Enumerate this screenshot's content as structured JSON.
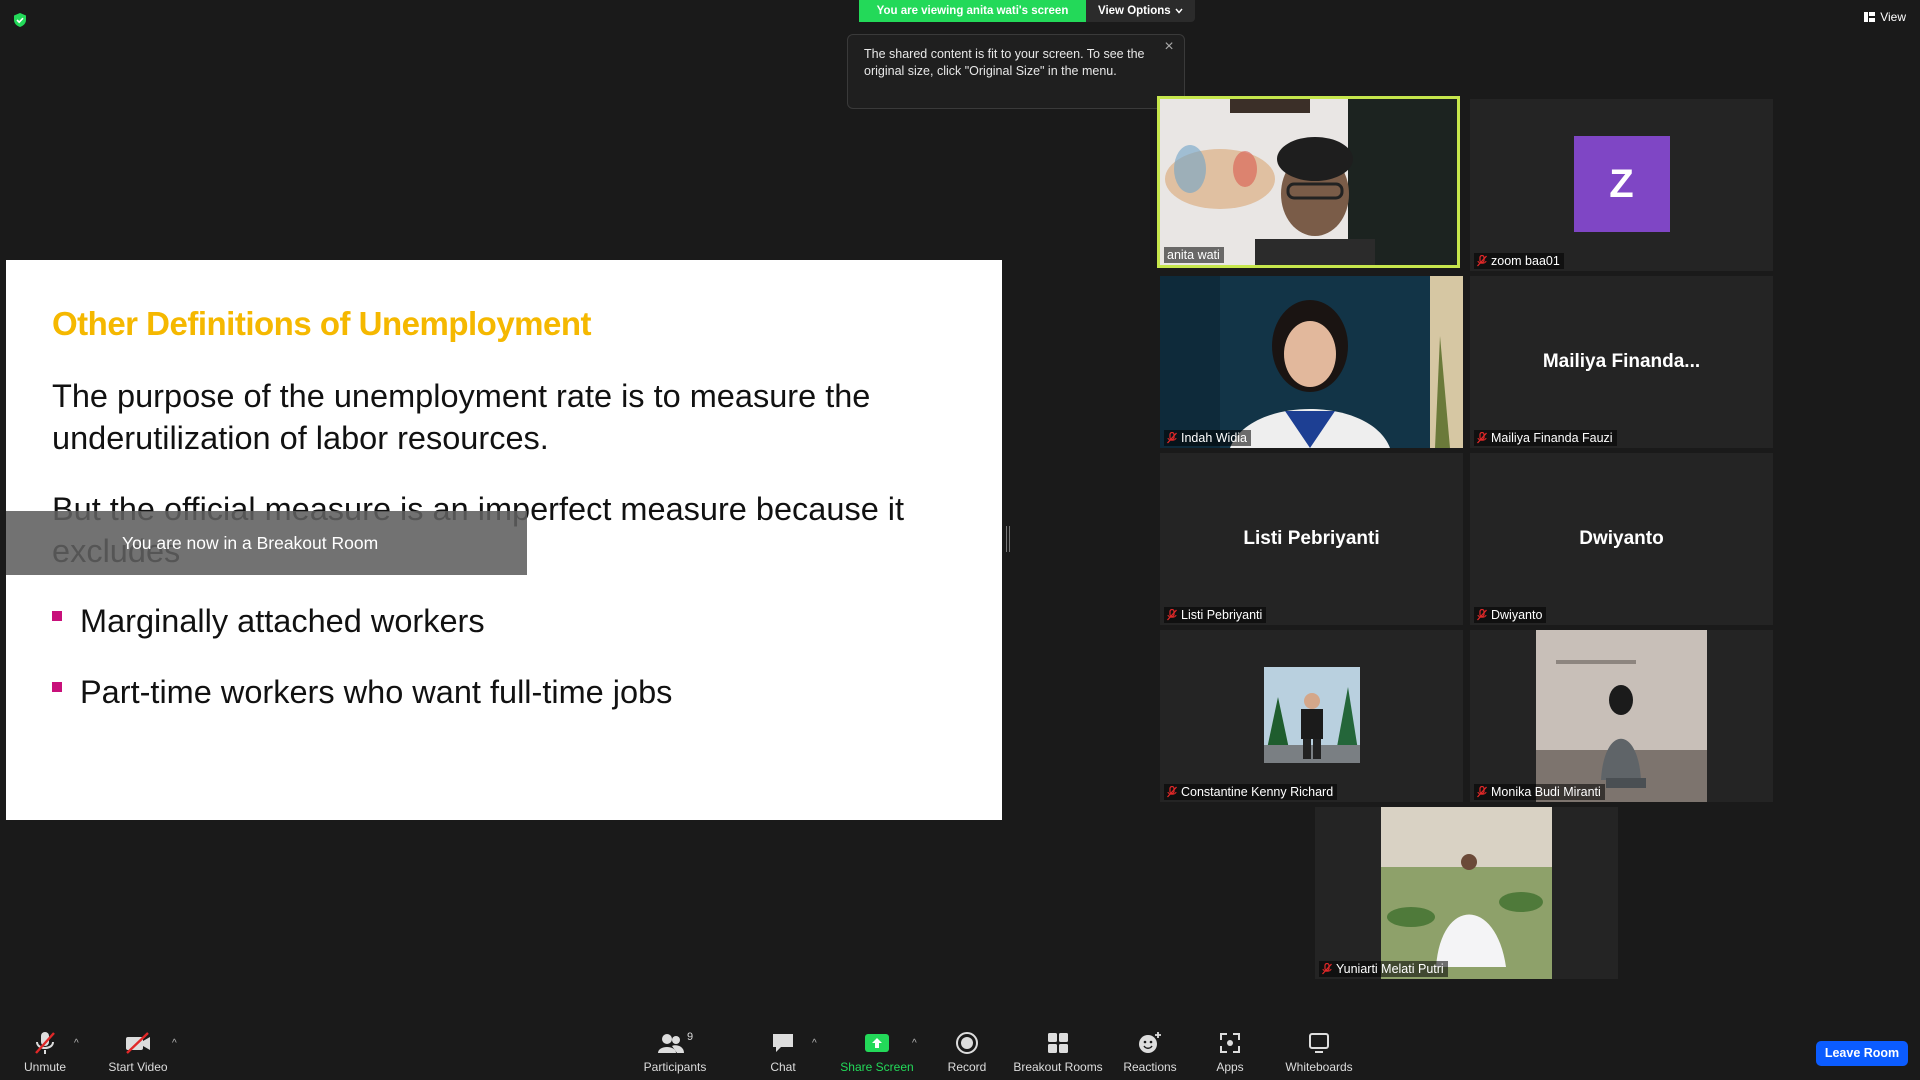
{
  "banner": {
    "viewing_text": "You are viewing anita wati's screen",
    "view_options_label": "View Options"
  },
  "top_right": {
    "view_label": "View"
  },
  "tooltip": {
    "text": "The shared content is fit to your screen. To see the original size, click \"Original Size\" in the menu."
  },
  "slide": {
    "title": "Other Definitions of Unemployment",
    "para1": "The purpose of the unemployment rate is to measure the underutilization of labor resources.",
    "para2": "But the official measure is an imperfect measure because it excludes",
    "bullets": [
      "Marginally attached workers",
      "Part-time workers who want full-time jobs"
    ],
    "title_color": "#f5b800",
    "bullet_color": "#c8107a"
  },
  "breakout_toast": "You are now in a Breakout Room",
  "participants": [
    {
      "label": "anita wati",
      "center_name": "",
      "muted": false,
      "active": true
    },
    {
      "label": "zoom baa01",
      "center_name": "",
      "avatar_letter": "Z",
      "muted": true
    },
    {
      "label": "Indah Widia",
      "center_name": "",
      "muted": true
    },
    {
      "label": "Mailiya Finanda Fauzi",
      "center_name": "Mailiya  Finanda...",
      "muted": true
    },
    {
      "label": "Listi Pebriyanti",
      "center_name": "Listi Pebriyanti",
      "muted": true
    },
    {
      "label": "Dwiyanto",
      "center_name": "Dwiyanto",
      "muted": true
    },
    {
      "label": "Constantine Kenny Richard",
      "center_name": "",
      "muted": true
    },
    {
      "label": "Monika Budi Miranti",
      "center_name": "",
      "muted": true
    },
    {
      "label": "Yuniarti Melati Putri",
      "center_name": "",
      "muted": true
    }
  ],
  "toolbar": {
    "unmute": "Unmute",
    "start_video": "Start Video",
    "participants": "Participants",
    "participants_count": "9",
    "chat": "Chat",
    "share_screen": "Share Screen",
    "record": "Record",
    "breakout_rooms": "Breakout Rooms",
    "reactions": "Reactions",
    "apps": "Apps",
    "whiteboards": "Whiteboards",
    "leave_room": "Leave Room"
  },
  "colors": {
    "active_speaker_border": "#c6e64c",
    "share_green": "#23d959",
    "leave_blue": "#0b5cff",
    "muted_red": "#e02828"
  }
}
